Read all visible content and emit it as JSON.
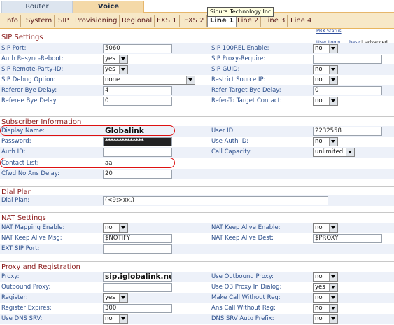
{
  "top_tabs": {
    "router": "Router",
    "voice": "Voice"
  },
  "sub_tabs": [
    "Info",
    "System",
    "SIP",
    "Provisioning",
    "Regional",
    "FXS 1",
    "FXS 2",
    "Line 1",
    "Line 2",
    "Line 3",
    "Line 4"
  ],
  "tooltip": "Sipura Technology Inc",
  "side_links": {
    "pbx_status": "PBX Status",
    "user_login": "User Login",
    "basic": "basic",
    "separator": "|",
    "advanced": "advanced"
  },
  "sip_settings": {
    "title": "SIP Settings",
    "rows": [
      {
        "left_label": "SIP Port:",
        "left_value": "5060",
        "right_label": "SIP 100REL Enable:",
        "right_value": "no"
      },
      {
        "left_label": "Auth Resync-Reboot:",
        "left_value": "yes",
        "right_label": "SIP Proxy-Require:",
        "right_value": ""
      },
      {
        "left_label": "SIP Remote-Party-ID:",
        "left_value": "yes",
        "right_label": "SIP GUID:",
        "right_value": "no"
      },
      {
        "left_label": "SIP Debug Option:",
        "left_value": "none",
        "right_label": "Restrict Source IP:",
        "right_value": "no"
      },
      {
        "left_label": "Referor Bye Delay:",
        "left_value": "4",
        "right_label": "Refer Target Bye Delay:",
        "right_value": "0"
      },
      {
        "left_label": "Referee Bye Delay:",
        "left_value": "0",
        "right_label": "Refer-To Target Contact:",
        "right_value": "no"
      }
    ]
  },
  "subscriber": {
    "title": "Subscriber Information",
    "display_name_label": "Display Name:",
    "display_name": "Globalink",
    "user_id_label": "User ID:",
    "user_id": "2232558",
    "password_label": "Password:",
    "password": "**************",
    "use_auth_id_label": "Use Auth ID:",
    "use_auth_id": "no",
    "auth_id_label": "Auth ID:",
    "auth_id": "",
    "call_capacity_label": "Call Capacity:",
    "call_capacity": "unlimited",
    "contact_list_label": "Contact List:",
    "contact_list": "aa",
    "cfwd_label": "Cfwd No Ans Delay:",
    "cfwd": "20"
  },
  "dial_plan": {
    "title": "Dial Plan",
    "label": "Dial Plan:",
    "value": "(<9:>xx.)"
  },
  "nat": {
    "title": "NAT Settings",
    "mapping_label": "NAT Mapping Enable:",
    "mapping": "no",
    "keep_alive_enable_label": "NAT Keep Alive Enable:",
    "keep_alive_enable": "no",
    "keep_alive_msg_label": "NAT Keep Alive Msg:",
    "keep_alive_msg": "$NOTIFY",
    "keep_alive_dest_label": "NAT Keep Alive Dest:",
    "keep_alive_dest": "$PROXY",
    "ext_sip_port_label": "EXT SIP Port:",
    "ext_sip_port": ""
  },
  "proxy": {
    "title": "Proxy and Registration",
    "proxy_label": "Proxy:",
    "proxy": "sip.iglobalink.net",
    "use_outbound_label": "Use Outbound Proxy:",
    "use_outbound": "no",
    "outbound_label": "Outbound Proxy:",
    "outbound": "",
    "use_ob_dialog_label": "Use OB Proxy In Dialog:",
    "use_ob_dialog": "yes",
    "register_label": "Register:",
    "register": "yes",
    "make_call_label": "Make Call Without Reg:",
    "make_call": "no",
    "expires_label": "Register Expires:",
    "expires": "300",
    "ans_call_label": "Ans Call Without Reg:",
    "ans_call": "no",
    "dns_srv_label": "Use DNS SRV:",
    "dns_srv": "no",
    "dns_srv_auto_label": "DNS SRV Auto Prefix:",
    "dns_srv_auto": "no"
  }
}
